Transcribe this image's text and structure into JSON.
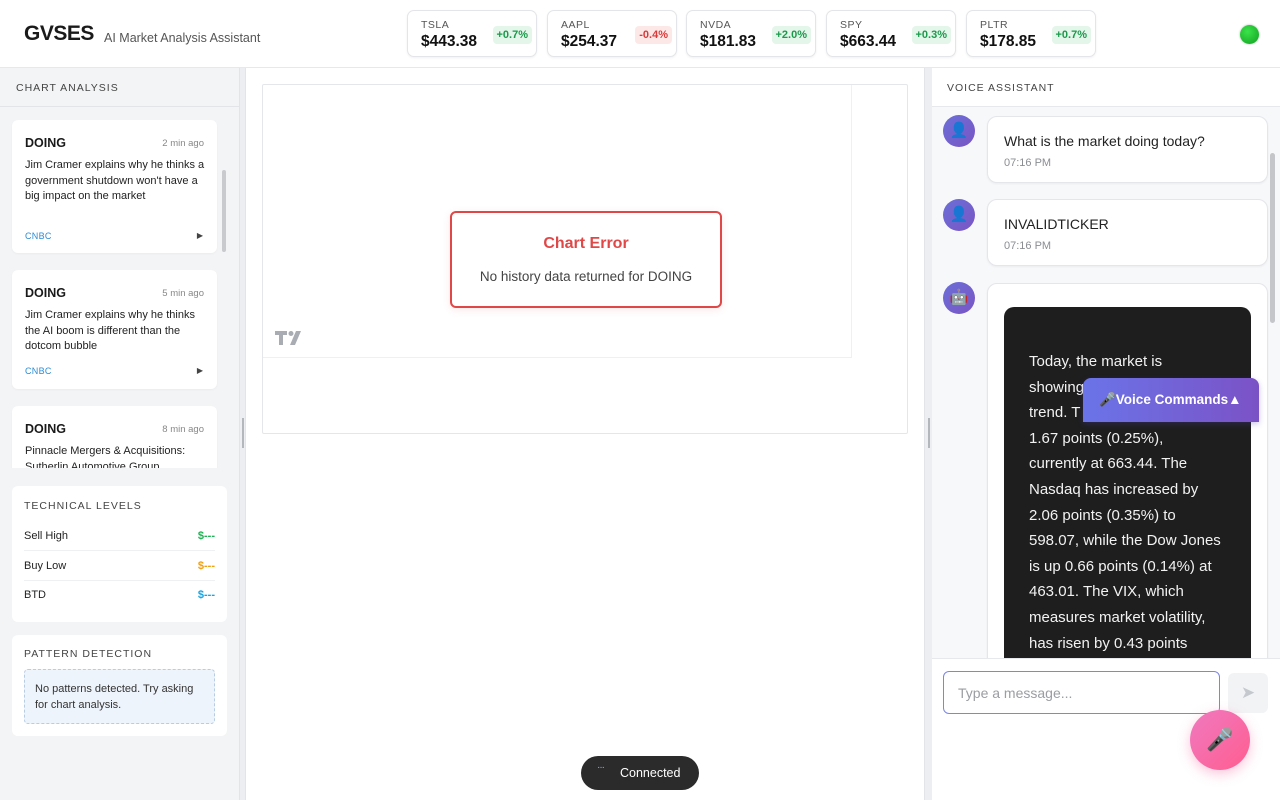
{
  "header": {
    "brand": "GVSES",
    "subtitle": "AI Market Analysis Assistant",
    "tickers": [
      {
        "symbol": "TSLA",
        "price": "$443.38",
        "change": "+0.7%",
        "direction": "up"
      },
      {
        "symbol": "AAPL",
        "price": "$254.37",
        "change": "-0.4%",
        "direction": "down"
      },
      {
        "symbol": "NVDA",
        "price": "$181.83",
        "change": "+2.0%",
        "direction": "up"
      },
      {
        "symbol": "SPY",
        "price": "$663.44",
        "change": "+0.3%",
        "direction": "up"
      },
      {
        "symbol": "PLTR",
        "price": "$178.85",
        "change": "+0.7%",
        "direction": "up"
      }
    ],
    "status_color": "#22c033"
  },
  "left": {
    "title": "CHART ANALYSIS",
    "news": [
      {
        "ticker": "DOING",
        "time": "2 min ago",
        "headline": "Jim Cramer explains why he thinks a government shutdown won't have a big impact on the market",
        "source": "CNBC",
        "play": "▶"
      },
      {
        "ticker": "DOING",
        "time": "5 min ago",
        "headline": "Jim Cramer explains why he thinks the AI boom is different than the dotcom bubble",
        "source": "CNBC",
        "play": "▶"
      },
      {
        "ticker": "DOING",
        "time": "8 min ago",
        "headline": "Pinnacle Mergers & Acquisitions: Sutherlin Automotive Group",
        "source": "",
        "play": ""
      }
    ],
    "technical": {
      "title": "TECHNICAL LEVELS",
      "levels": [
        {
          "name": "Sell High",
          "value": "$---",
          "color": "#1fb254"
        },
        {
          "name": "Buy Low",
          "value": "$---",
          "color": "#f0a012"
        },
        {
          "name": "BTD",
          "value": "$---",
          "color": "#1aa3e0"
        }
      ]
    },
    "pattern": {
      "title": "PATTERN DETECTION",
      "message": "No patterns detected. Try asking for chart analysis."
    }
  },
  "center": {
    "error_title": "Chart Error",
    "error_message": "No history data returned for DOING",
    "connection": "Connected"
  },
  "right": {
    "title": "VOICE ASSISTANT",
    "messages": [
      {
        "role": "user",
        "text": "What is the market doing today?",
        "time": "07:16 PM"
      },
      {
        "role": "user",
        "text": "INVALIDTICKER",
        "time": "07:16 PM"
      }
    ],
    "assistant_lines": [
      "Today, the market is",
      "showing",
      "trend. T",
      "1.67 points (0.25%),",
      "currently at 663.44. The",
      "Nasdaq has increased by",
      "2.06 points (0.35%) to",
      "598.07, while the Dow Jones",
      "is up 0.66 points (0.14%) at",
      "463.01. The VIX, which",
      "measures market volatility,",
      "has risen by 0.43 points"
    ],
    "voice_commands": "🎤Voice Commands▲",
    "input_placeholder": "Type a message...",
    "send_icon": "send-icon",
    "mic_icon": "mic-icon"
  }
}
